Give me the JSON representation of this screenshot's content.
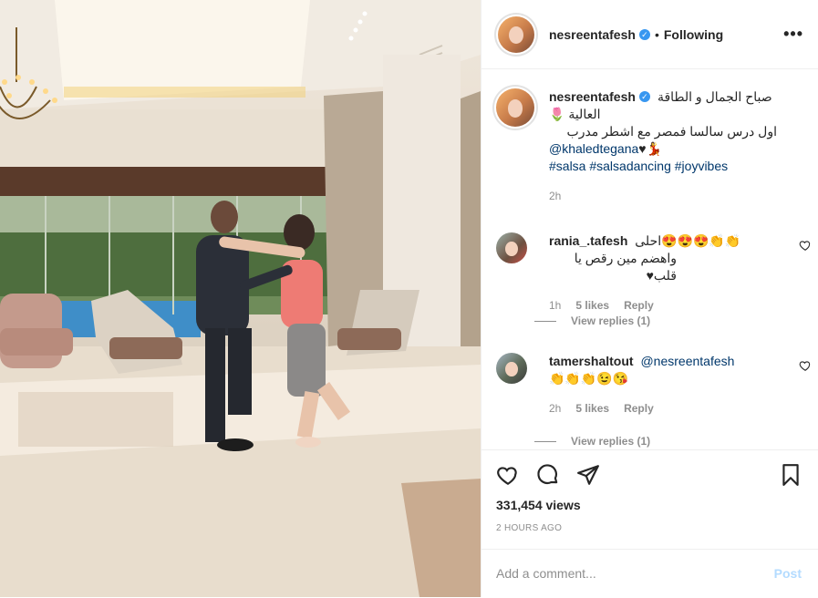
{
  "header": {
    "username": "nesreentafesh",
    "separator": "•",
    "follow_status": "Following",
    "more": "•••"
  },
  "caption": {
    "username": "nesreentafesh",
    "line1": "صباح الجمال و الطاقة",
    "line2": "العالية 🌷",
    "line3": "اول درس سالسا فمصر مع اشطر مدرب",
    "mention": "@khaledtegana",
    "mention_suffix": "♥💃",
    "hashtags": [
      "#salsa",
      "#salsadancing",
      "#joyvibes"
    ],
    "time": "2h"
  },
  "comments": [
    {
      "username": "rania_.tafesh",
      "line1": "احلى😍😍😍👏👏",
      "line2": "واهضم مين رقص يا قلب♥",
      "time": "1h",
      "likes": "5 likes",
      "reply": "Reply",
      "view_replies": "View replies (1)"
    },
    {
      "username": "tamershaltout",
      "mention": "@nesreentafesh",
      "line2": "👏👏👏😉😘",
      "time": "2h",
      "likes": "5 likes",
      "reply": "Reply",
      "view_replies": "View replies (1)"
    }
  ],
  "stats": {
    "views": "331,454 views",
    "posted_ago": "2 HOURS AGO"
  },
  "add_comment": {
    "placeholder": "Add a comment...",
    "post_label": "Post"
  },
  "colors": {
    "link": "#00376b",
    "verified": "#3897f0",
    "muted": "#8e8e8e",
    "post_disabled": "#b3dbff"
  },
  "icons": {
    "header_more": "more-icon",
    "verified": "verified-badge-icon",
    "like": "heart-icon",
    "comment": "comment-bubble-icon",
    "share": "paper-plane-icon",
    "save": "bookmark-icon",
    "comment_like": "small-heart-icon"
  }
}
